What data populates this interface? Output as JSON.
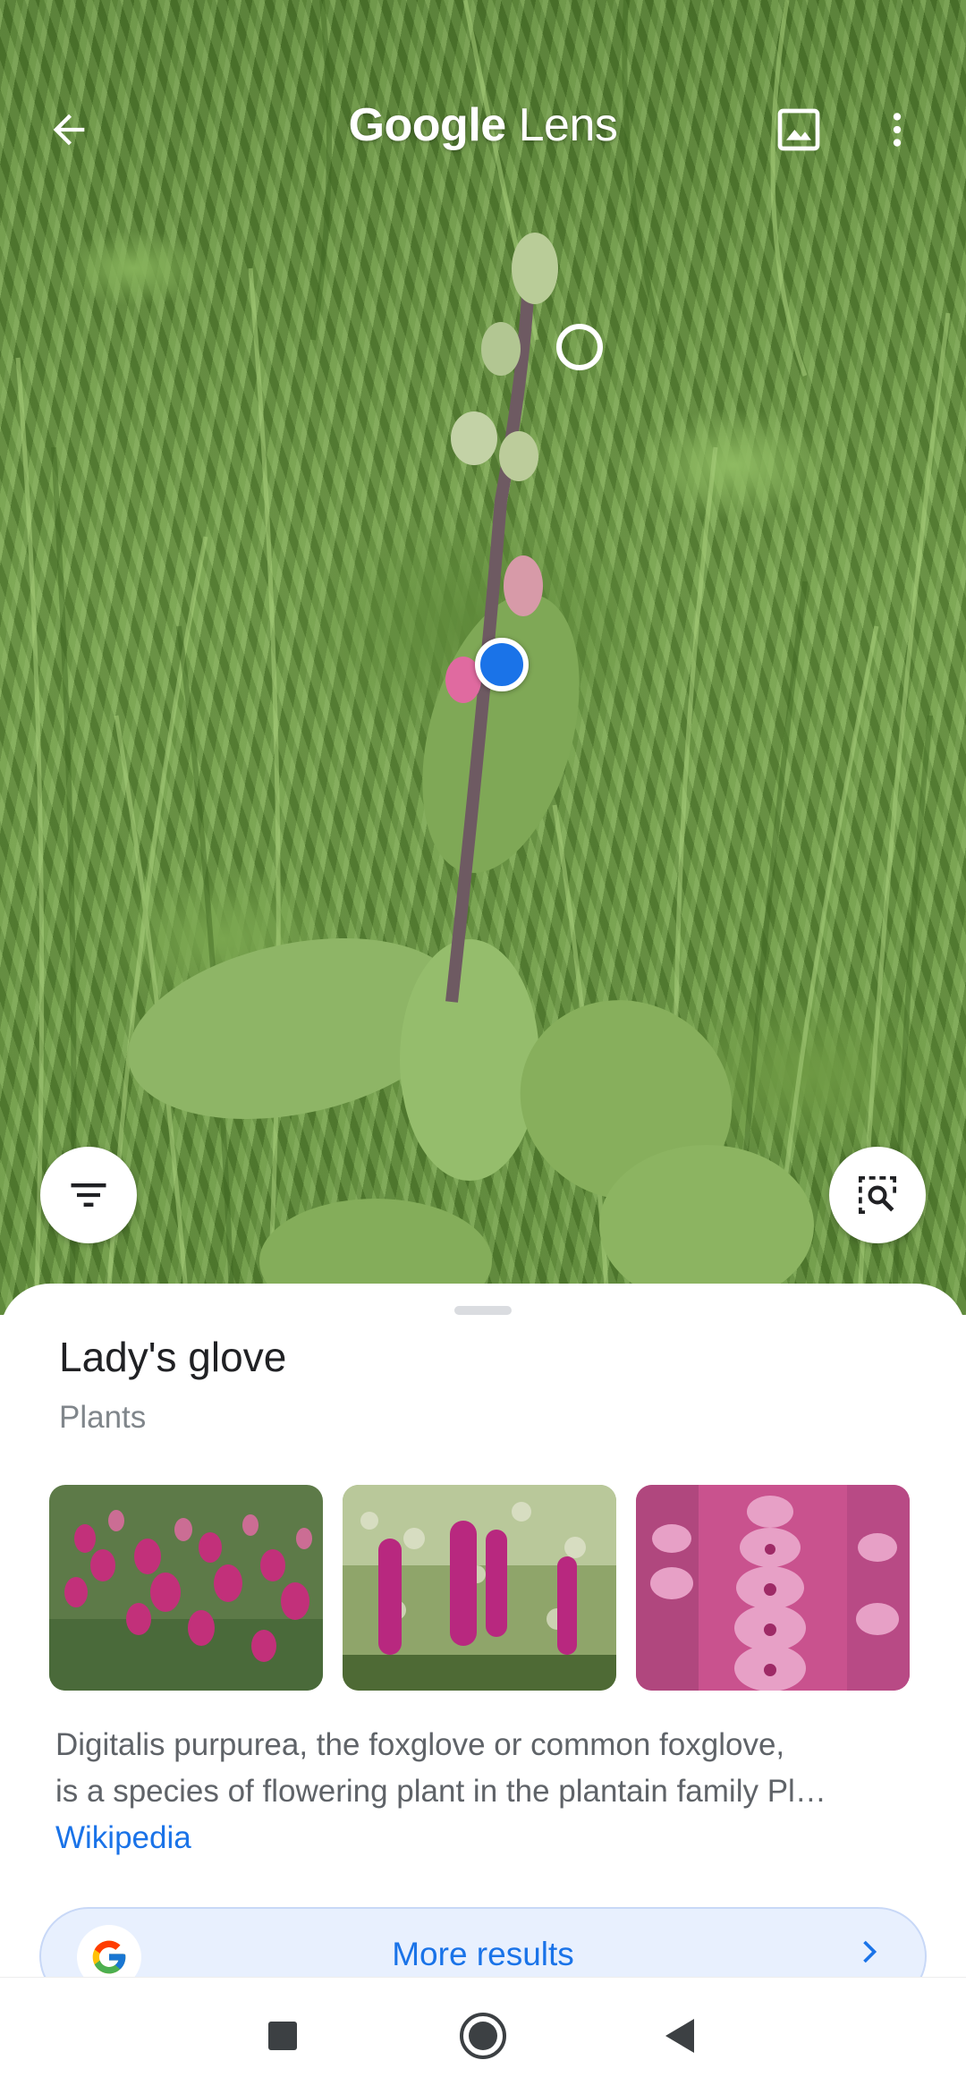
{
  "app": {
    "title_google": "Google",
    "title_lens": "Lens"
  },
  "topbar": {
    "back_icon": "arrow-back-icon",
    "gallery_icon": "image-icon",
    "menu_icon": "more-vert-icon"
  },
  "photo_controls": {
    "filter_icon": "filter-icon",
    "search_region_icon": "image-search-icon"
  },
  "result": {
    "title": "Lady's glove",
    "category": "Plants",
    "images": [
      {
        "alt_icon": "foxglove-image-1"
      },
      {
        "alt_icon": "foxglove-image-2"
      },
      {
        "alt_icon": "foxglove-image-3"
      }
    ],
    "description_line1": "Digitalis purpurea, the foxglove or common foxglove,",
    "description_line2": "is a species of flowering plant in the plantain family Pl…",
    "source_link": "Wikipedia"
  },
  "more_results": {
    "label": "More results"
  },
  "navbar": {
    "recents_icon": "square-icon",
    "home_icon": "circle-icon",
    "back_icon": "triangle-back-icon"
  },
  "colors": {
    "accent": "#1a73e8",
    "pill_bg": "#e8f0fe",
    "text_primary": "#202124",
    "text_secondary": "#5f6368"
  }
}
